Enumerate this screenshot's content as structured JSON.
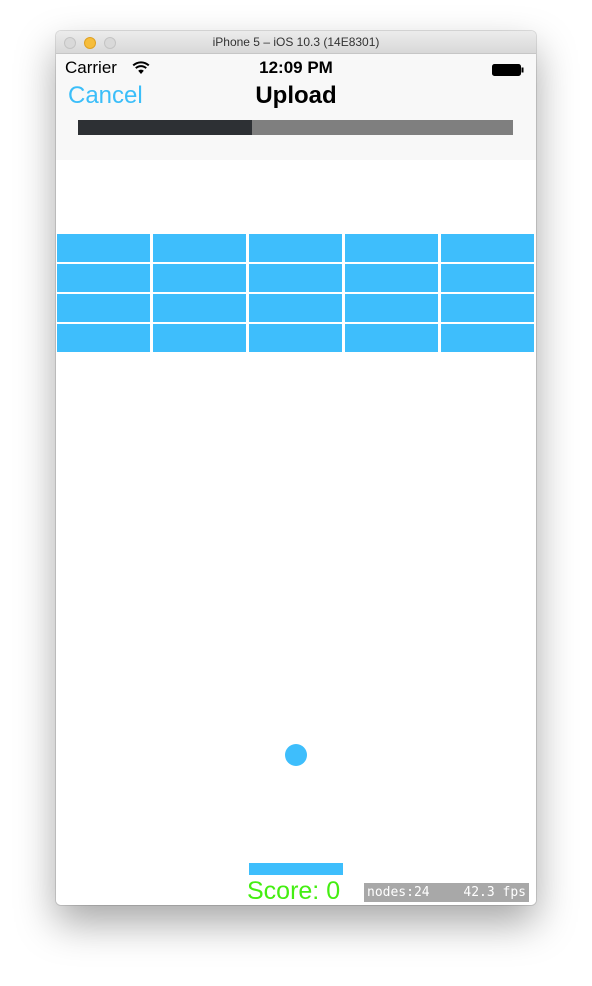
{
  "window": {
    "title": "iPhone 5 – iOS 10.3 (14E8301)"
  },
  "status_bar": {
    "carrier": "Carrier",
    "time": "12:09 PM",
    "wifi_icon": "wifi-icon",
    "battery_icon": "battery-full-icon"
  },
  "nav": {
    "cancel_label": "Cancel",
    "title": "Upload"
  },
  "upload_progress": {
    "fraction": 0.4
  },
  "game": {
    "brick_rows": 4,
    "brick_columns": 5,
    "score_text": "Score: 0",
    "stats": {
      "nodes": "nodes:24",
      "fps": "42.3 fps"
    }
  },
  "colors": {
    "accent": "#3bbef9",
    "brick": "#3ebefc",
    "score": "#44ee11",
    "progress_fill": "#2d3034",
    "progress_track": "#7f7f7f"
  }
}
